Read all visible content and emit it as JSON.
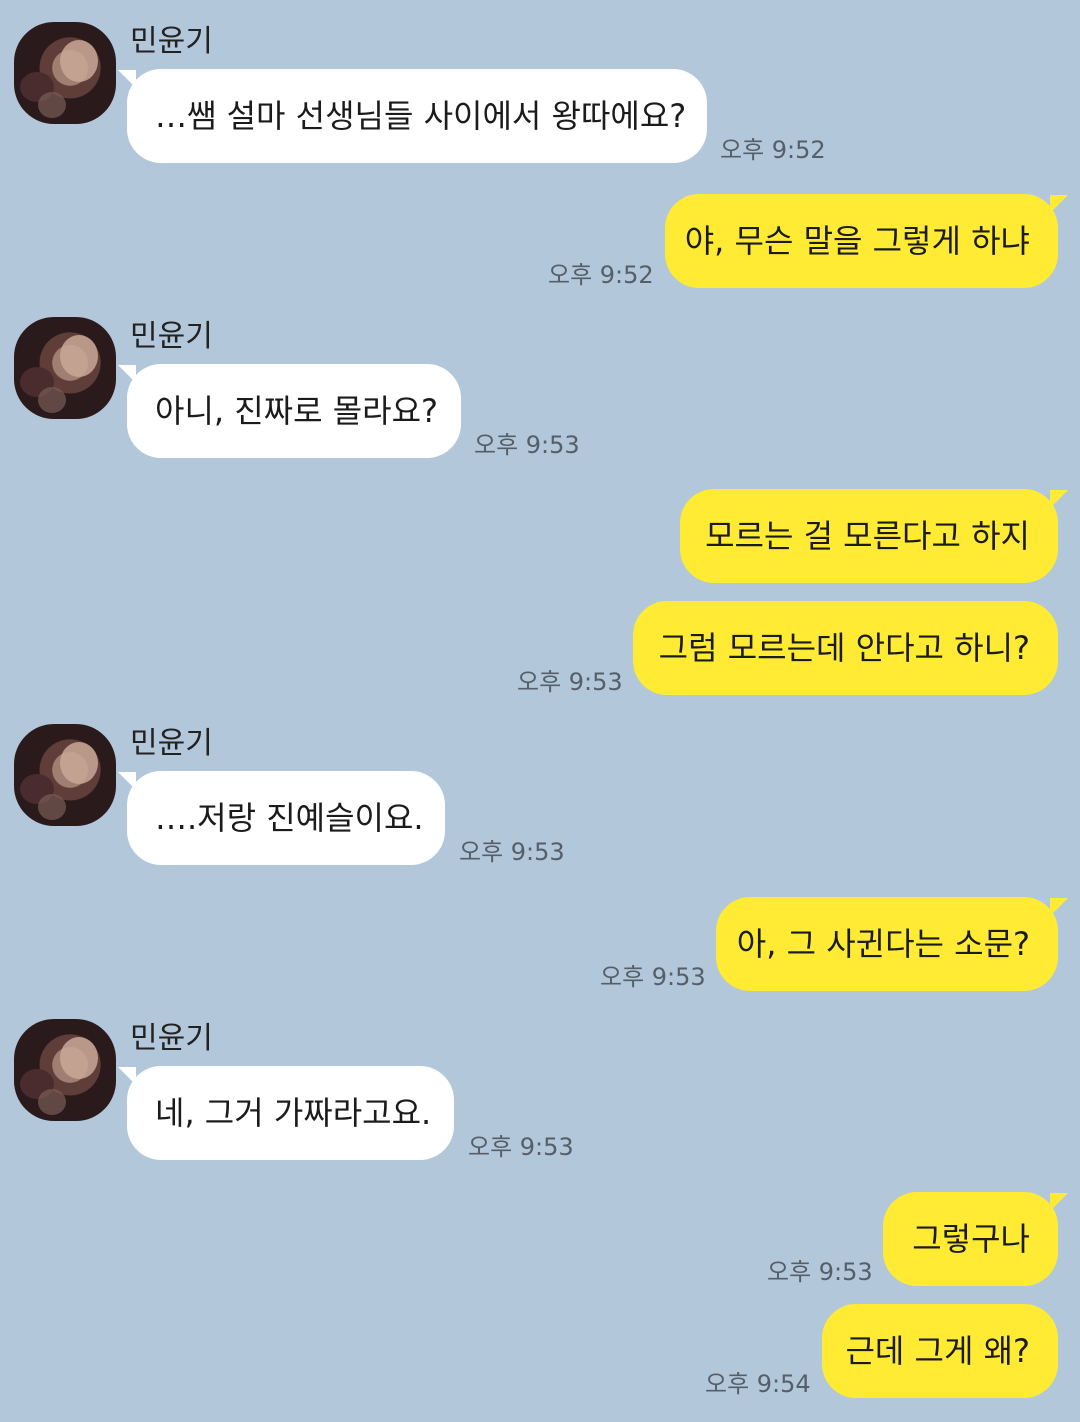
{
  "chat": {
    "contact_name": "민윤기",
    "messages": [
      {
        "dir": "in",
        "text": "…쌤 설마 선생님들 사이에서 왕따에요?",
        "time": "오후 9:52"
      },
      {
        "dir": "out",
        "text": "야, 무슨 말을 그렇게 하냐",
        "time": "오후 9:52"
      },
      {
        "dir": "in",
        "text": "아니, 진짜로 몰라요?",
        "time": "오후 9:53"
      },
      {
        "dir": "out",
        "text": "모르는 걸 모른다고 하지",
        "time": ""
      },
      {
        "dir": "out",
        "text": "그럼 모르는데 안다고 하니?",
        "time": "오후 9:53"
      },
      {
        "dir": "in",
        "text": "….저랑 진예슬이요.",
        "time": "오후 9:53"
      },
      {
        "dir": "out",
        "text": "아, 그 사귄다는 소문?",
        "time": "오후 9:53"
      },
      {
        "dir": "in",
        "text": "네, 그거 가짜라고요.",
        "time": "오후 9:53"
      },
      {
        "dir": "out",
        "text": "그렇구나",
        "time": "오후 9:53"
      },
      {
        "dir": "out",
        "text": "근데 그게 왜?",
        "time": "오후 9:54"
      }
    ]
  },
  "colors": {
    "background": "#b2c7da",
    "incoming_bubble": "#ffffff",
    "outgoing_bubble": "#ffeb33",
    "timestamp": "#555f69"
  }
}
